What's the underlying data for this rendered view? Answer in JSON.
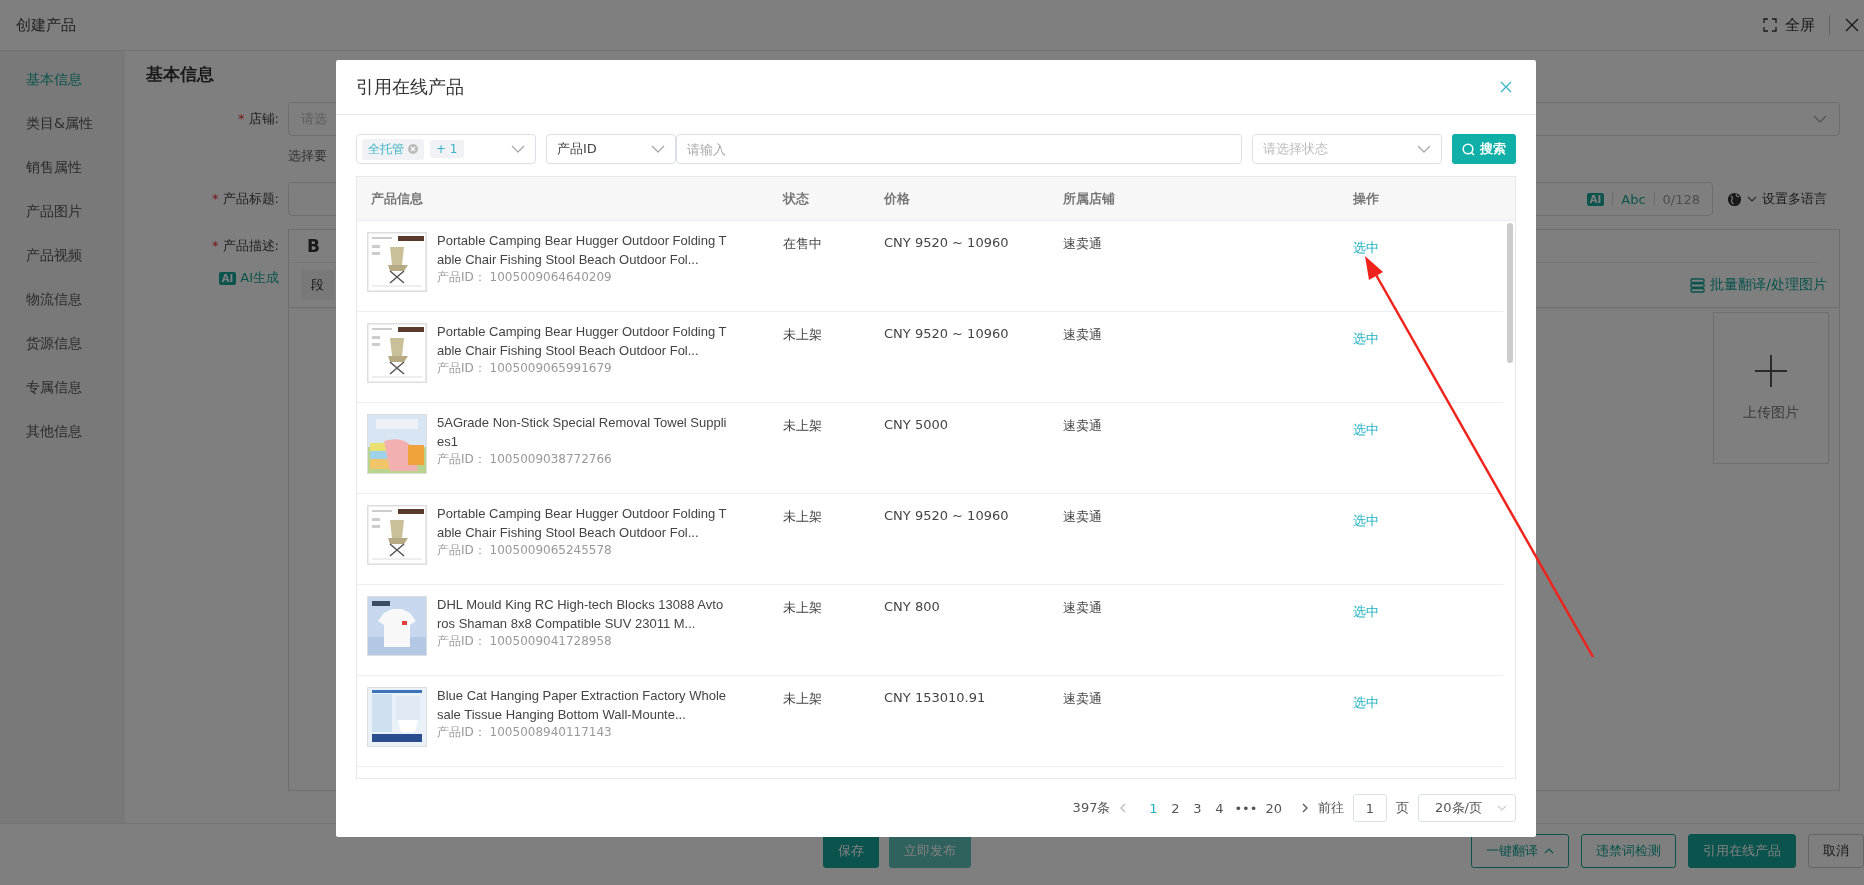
{
  "page": {
    "title": "创建产品",
    "fullscreen_label": "全屏"
  },
  "sidebar": {
    "items": [
      {
        "label": "基本信息",
        "selected": true
      },
      {
        "label": "类目&属性",
        "selected": false
      },
      {
        "label": "销售属性",
        "selected": false
      },
      {
        "label": "产品图片",
        "selected": false
      },
      {
        "label": "产品视频",
        "selected": false
      },
      {
        "label": "物流信息",
        "selected": false
      },
      {
        "label": "货源信息",
        "selected": false
      },
      {
        "label": "专属信息",
        "selected": false
      },
      {
        "label": "其他信息",
        "selected": false
      }
    ]
  },
  "form": {
    "heading": "基本信息",
    "shop": {
      "required_mark": "*",
      "label": "店铺:",
      "placeholder": "请选"
    },
    "shop_hint": "选择要",
    "title_field": {
      "required_mark": "*",
      "label": "产品标题:",
      "ai_badge": "AI",
      "abc": "Abc",
      "counter": "0/128",
      "multilang": "设置多语言"
    },
    "description": {
      "required_mark": "*",
      "label": "产品描述:",
      "ai_badge": "AI",
      "ai_generate": "AI生成",
      "bold": "B",
      "paragraph": "段",
      "batch": "批量翻译/处理图片",
      "upload": "上传图片"
    }
  },
  "footer": {
    "center_buttons": [
      {
        "label": "保存",
        "kind": "primary"
      },
      {
        "label": "立即发布",
        "kind": "light"
      }
    ],
    "right_buttons": [
      {
        "label": "一键翻译",
        "kind": "dropdown"
      },
      {
        "label": "违禁词检测",
        "kind": "outline"
      },
      {
        "label": "引用在线产品",
        "kind": "primary"
      },
      {
        "label": "取消",
        "kind": "plain"
      }
    ]
  },
  "modal": {
    "title": "引用在线产品",
    "filters": {
      "tags": [
        "全托管"
      ],
      "more_tag": "+ 1",
      "id_select": "产品ID",
      "search_placeholder": "请输入",
      "status_placeholder": "请选择状态",
      "search_button": "搜索"
    },
    "table": {
      "columns": [
        "产品信息",
        "状态",
        "价格",
        "所属店铺",
        "操作"
      ],
      "rows": [
        {
          "title": "Portable Camping Bear Hugger Outdoor Folding Table Chair Fishing Stool Beach Outdoor Fol...",
          "id_label": "产品ID：",
          "id": "1005009064640209",
          "status": "在售中",
          "price": "CNY 9520 ~ 10960",
          "shop": "速卖通",
          "action": "选中"
        },
        {
          "title": "Portable Camping Bear Hugger Outdoor Folding Table Chair Fishing Stool Beach Outdoor Fol...",
          "id_label": "产品ID：",
          "id": "1005009065991679",
          "status": "未上架",
          "price": "CNY 9520 ~ 10960",
          "shop": "速卖通",
          "action": "选中"
        },
        {
          "title": "5AGrade Non-Stick Special Removal  Towel Supplies1",
          "id_label": "产品ID：",
          "id": "1005009038772766",
          "status": "未上架",
          "price": "CNY 5000",
          "shop": "速卖通",
          "action": "选中"
        },
        {
          "title": "Portable Camping Bear Hugger Outdoor Folding Table Chair Fishing Stool Beach Outdoor Fol...",
          "id_label": "产品ID：",
          "id": "1005009065245578",
          "status": "未上架",
          "price": "CNY 9520 ~ 10960",
          "shop": "速卖通",
          "action": "选中"
        },
        {
          "title": "DHL Mould King RC High-tech Blocks 13088 Avtoros Shaman 8x8 Compatible SUV 23011 M...",
          "id_label": "产品ID：",
          "id": "1005009041728958",
          "status": "未上架",
          "price": "CNY 800",
          "shop": "速卖通",
          "action": "选中"
        },
        {
          "title": "Blue Cat Hanging Paper Extraction Factory Wholesale Tissue Hanging Bottom Wall-Mounte...",
          "id_label": "产品ID：",
          "id": "1005008940117143",
          "status": "未上架",
          "price": "CNY 153010.91",
          "shop": "速卖通",
          "action": "选中"
        }
      ]
    },
    "pagination": {
      "total": "397条",
      "pages": [
        {
          "label": "1",
          "selected": true
        },
        {
          "label": "2",
          "selected": false
        },
        {
          "label": "3",
          "selected": false
        },
        {
          "label": "4",
          "selected": false
        }
      ],
      "ellipsis": "•••",
      "last": "20",
      "goto_label": "前往",
      "goto_value": "1",
      "page_unit": "页",
      "page_size": "20条/页"
    }
  }
}
